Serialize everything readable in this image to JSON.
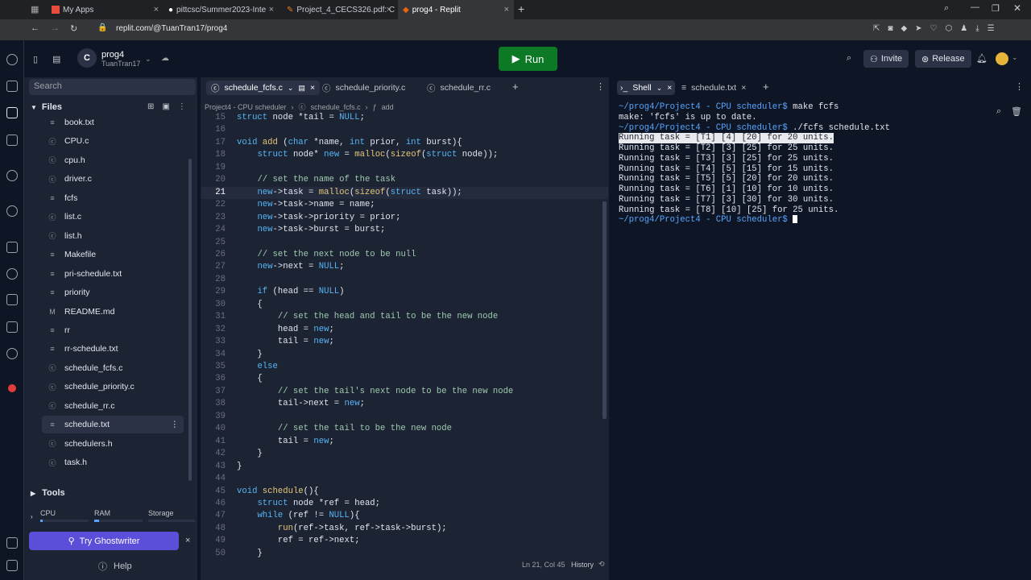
{
  "browser": {
    "tabs": [
      "My Apps",
      "pittcsc/Summer2023-Inte",
      "Project_4_CECS326.pdf: C",
      "prog4 - Replit"
    ],
    "url": "replit.com/@TuanTran17/prog4"
  },
  "header": {
    "repl_name": "prog4",
    "owner": "TuanTran17",
    "run_label": "Run",
    "invite_label": "Invite",
    "release_label": "Release"
  },
  "sidebar": {
    "search_placeholder": "Search",
    "files_label": "Files",
    "files": [
      "book.txt",
      "CPU.c",
      "cpu.h",
      "driver.c",
      "fcfs",
      "list.c",
      "list.h",
      "Makefile",
      "pri-schedule.txt",
      "priority",
      "README.md",
      "rr",
      "rr-schedule.txt",
      "schedule_fcfs.c",
      "schedule_priority.c",
      "schedule_rr.c",
      "schedule.txt",
      "schedulers.h",
      "task.h"
    ],
    "selected_file": "schedule.txt",
    "tools_label": "Tools",
    "resources": [
      "CPU",
      "RAM",
      "Storage"
    ],
    "ghostwriter_label": "Try Ghostwriter",
    "help_label": "Help"
  },
  "editor": {
    "tabs": [
      "schedule_fcfs.c",
      "schedule_priority.c",
      "schedule_rr.c"
    ],
    "breadcrumb": [
      "Project4 - CPU scheduler",
      "schedule_fcfs.c",
      "add"
    ],
    "status_position": "Ln 21, Col 45",
    "history_label": "History",
    "current_line": 21,
    "lines": [
      {
        "n": "15",
        "code": "struct node *tail = NULL;"
      },
      {
        "n": "16",
        "code": ""
      },
      {
        "n": "17",
        "code": "void add (char *name, int prior, int burst){"
      },
      {
        "n": "18",
        "code": "    struct node* new = malloc(sizeof(struct node));"
      },
      {
        "n": "19",
        "code": ""
      },
      {
        "n": "20",
        "code": "    // set the name of the task"
      },
      {
        "n": "21",
        "code": "    new->task = malloc(sizeof(struct task));"
      },
      {
        "n": "22",
        "code": "    new->task->name = name;"
      },
      {
        "n": "23",
        "code": "    new->task->priority = prior;"
      },
      {
        "n": "24",
        "code": "    new->task->burst = burst;"
      },
      {
        "n": "25",
        "code": ""
      },
      {
        "n": "26",
        "code": "    // set the next node to be null"
      },
      {
        "n": "27",
        "code": "    new->next = NULL;"
      },
      {
        "n": "28",
        "code": ""
      },
      {
        "n": "29",
        "code": "    if (head == NULL)"
      },
      {
        "n": "30",
        "code": "    {"
      },
      {
        "n": "31",
        "code": "        // set the head and tail to be the new node"
      },
      {
        "n": "32",
        "code": "        head = new;"
      },
      {
        "n": "33",
        "code": "        tail = new;"
      },
      {
        "n": "34",
        "code": "    }"
      },
      {
        "n": "35",
        "code": "    else"
      },
      {
        "n": "36",
        "code": "    {"
      },
      {
        "n": "37",
        "code": "        // set the tail's next node to be the new node"
      },
      {
        "n": "38",
        "code": "        tail->next = new;"
      },
      {
        "n": "39",
        "code": ""
      },
      {
        "n": "40",
        "code": "        // set the tail to be the new node"
      },
      {
        "n": "41",
        "code": "        tail = new;"
      },
      {
        "n": "42",
        "code": "    }"
      },
      {
        "n": "43",
        "code": "}"
      },
      {
        "n": "44",
        "code": ""
      },
      {
        "n": "45",
        "code": "void schedule(){"
      },
      {
        "n": "46",
        "code": "    struct node *ref = head;"
      },
      {
        "n": "47",
        "code": "    while (ref != NULL){"
      },
      {
        "n": "48",
        "code": "        run(ref->task, ref->task->burst);"
      },
      {
        "n": "49",
        "code": "        ref = ref->next;"
      },
      {
        "n": "50",
        "code": "    }"
      }
    ]
  },
  "shell": {
    "tabs": [
      "Shell",
      "schedule.txt"
    ],
    "lines": [
      {
        "prompt": "~/prog4/Project4 - CPU scheduler$",
        "cmd": " make fcfs"
      },
      {
        "text": "make: 'fcfs' is up to date."
      },
      {
        "prompt": "~/prog4/Project4 - CPU scheduler$",
        "cmd": " ./fcfs schedule.txt"
      },
      {
        "text": "Running task = [T1] [4] [20] for 20 units.",
        "highlight": true
      },
      {
        "text": "Running task = [T2] [3] [25] for 25 units."
      },
      {
        "text": "Running task = [T3] [3] [25] for 25 units."
      },
      {
        "text": "Running task = [T4] [5] [15] for 15 units."
      },
      {
        "text": "Running task = [T5] [5] [20] for 20 units."
      },
      {
        "text": "Running task = [T6] [1] [10] for 10 units."
      },
      {
        "text": "Running task = [T7] [3] [30] for 30 units."
      },
      {
        "text": "Running task = [T8] [10] [25] for 25 units."
      },
      {
        "prompt": "~/prog4/Project4 - CPU scheduler$",
        "cmd": " "
      }
    ]
  },
  "colors": {
    "run_button": "#0c7a24",
    "ghostwriter": "#5b4ed9",
    "prompt": "#58a6ff"
  }
}
